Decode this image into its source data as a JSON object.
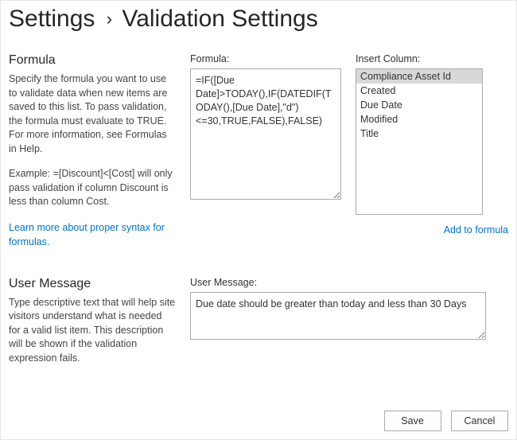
{
  "breadcrumb": {
    "root": "Settings",
    "current": "Validation Settings"
  },
  "formulaSection": {
    "title": "Formula",
    "description": "Specify the formula you want to use to validate data when new items are saved to this list. To pass validation, the formula must evaluate to TRUE. For more information, see Formulas in Help.",
    "example": "Example: =[Discount]<[Cost] will only pass validation if column Discount is less than column Cost.",
    "helpLink": "Learn more about proper syntax for formulas.",
    "formulaLabel": "Formula:",
    "formulaValue": "=IF([Due Date]>TODAY(),IF(DATEDIF(TODAY(),[Due Date],\"d\")<=30,TRUE,FALSE),FALSE)",
    "insertColumnLabel": "Insert Column:",
    "columns": [
      "Compliance Asset Id",
      "Created",
      "Due Date",
      "Modified",
      "Title"
    ],
    "selectedColumnIndex": 0,
    "addToFormula": "Add to formula"
  },
  "userMessageSection": {
    "title": "User Message",
    "description": "Type descriptive text that will help site visitors understand what is needed for a valid list item. This description will be shown if the validation expression fails.",
    "label": "User Message:",
    "value": "Due date should be greater than today and less than 30 Days"
  },
  "buttons": {
    "save": "Save",
    "cancel": "Cancel"
  }
}
